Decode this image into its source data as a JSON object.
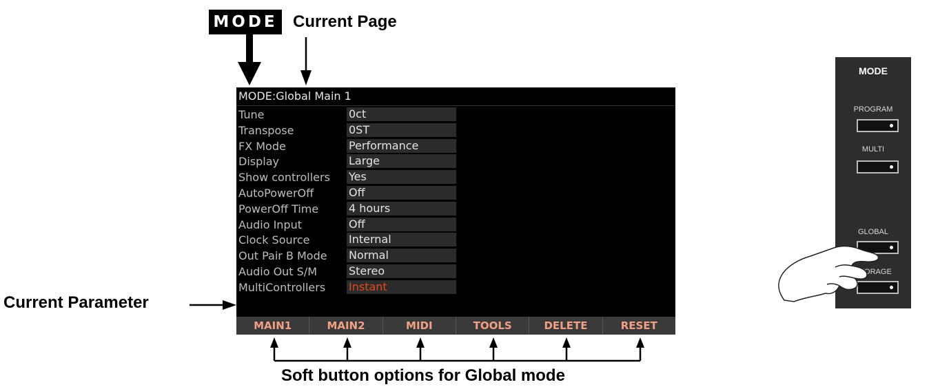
{
  "annotations": {
    "mode_tag": "MODE",
    "current_page": "Current Page",
    "current_parameter": "Current Parameter",
    "soft_button_caption": "Soft button options for Global mode"
  },
  "screen": {
    "title": "MODE:Global Main 1",
    "params": [
      {
        "name": "Tune",
        "value": "0ct"
      },
      {
        "name": "Transpose",
        "value": "0ST"
      },
      {
        "name": "FX Mode",
        "value": "Performance"
      },
      {
        "name": "Display",
        "value": "Large"
      },
      {
        "name": "Show controllers",
        "value": "Yes"
      },
      {
        "name": "AutoPowerOff",
        "value": "Off"
      },
      {
        "name": "PowerOff Time",
        "value": "4 hours"
      },
      {
        "name": "Audio Input",
        "value": "Off"
      },
      {
        "name": "Clock Source",
        "value": "Internal"
      },
      {
        "name": "Out Pair B Mode",
        "value": "Normal"
      },
      {
        "name": "Audio Out S/M",
        "value": "Stereo"
      },
      {
        "name": "MultiControllers",
        "value": "Instant",
        "active": true
      }
    ],
    "soft_buttons": [
      "MAIN1",
      "MAIN2",
      "MIDI",
      "TOOLS",
      "DELETE",
      "RESET"
    ],
    "colors": {
      "active_value": "#e04b20",
      "soft_button_text": "#f0a085"
    }
  },
  "panel": {
    "title": "MODE",
    "buttons": [
      {
        "label": "PROGRAM"
      },
      {
        "label": "MULTI"
      },
      {
        "label": "GLOBAL"
      },
      {
        "label": "STORAGE"
      }
    ]
  }
}
